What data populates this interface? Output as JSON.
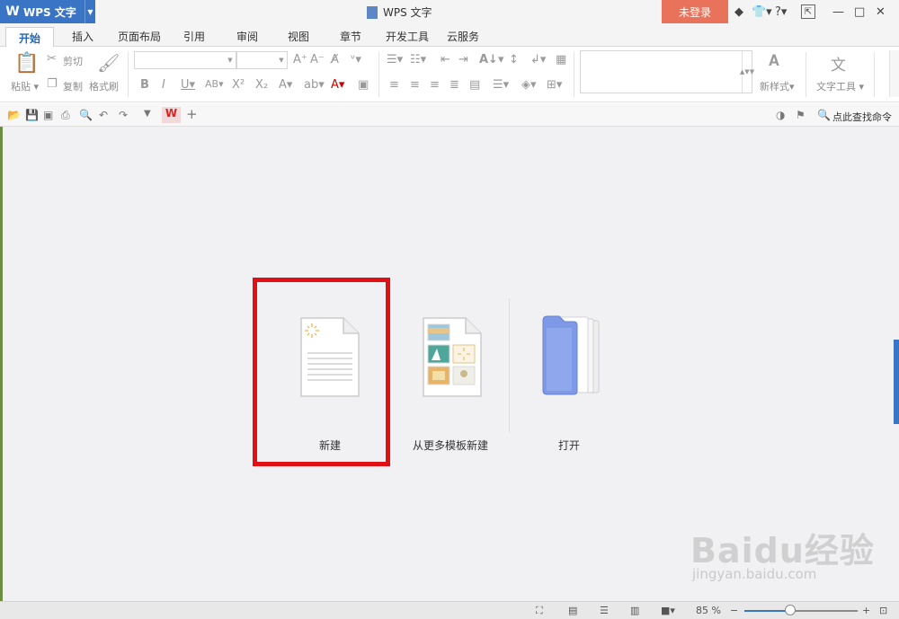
{
  "titlebar": {
    "app_name": "WPS 文字",
    "window_title": "WPS 文字",
    "login": "未登录"
  },
  "tabs": [
    "开始",
    "插入",
    "页面布局",
    "引用",
    "审阅",
    "视图",
    "章节",
    "开发工具",
    "云服务"
  ],
  "ribbon": {
    "paste": "粘贴",
    "cut": "剪切",
    "copy": "复制",
    "format_painter": "格式刷",
    "new_style": "新样式",
    "text_tools": "文字工具"
  },
  "quick_access": {
    "search_command": "点此查找命令"
  },
  "main": {
    "actions": [
      {
        "label": "新建",
        "icon": "blank-document-icon"
      },
      {
        "label": "从更多模板新建",
        "icon": "template-document-icon"
      },
      {
        "label": "打开",
        "icon": "folder-icon"
      }
    ]
  },
  "statusbar": {
    "zoom": "85 %"
  },
  "watermark": {
    "text": "Baidu经验",
    "sub": "jingyan.baidu.com"
  },
  "colors": {
    "accent": "#3a74c4",
    "login": "#e9735a",
    "highlight": "#e01015"
  }
}
